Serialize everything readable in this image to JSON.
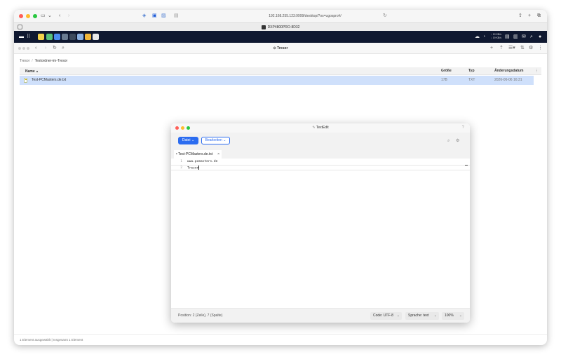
{
  "browser": {
    "url": "192.168.255.123:9999/desktop/?os=ugospro#/",
    "tab_title": "DXP4800PRO-8D32",
    "icons": [
      "sidebar-icon",
      "chevron-down-icon",
      "back-icon",
      "forward-icon",
      "shield-icon",
      "bitwarden-icon",
      "image-icon",
      "tab-icon",
      "reload-icon",
      "share-icon",
      "new-tab-icon",
      "tabs-overview-icon"
    ]
  },
  "nas": {
    "taskbar_icons": [
      "app-store-icon",
      "photos-icon",
      "file-manager-icon",
      "settings-icon",
      "monitor-icon",
      "docker-icon",
      "folder-icon",
      "textedit-icon"
    ],
    "speed_up": "↑ 19 KB/s",
    "speed_down": "↓ 19 KB/s"
  },
  "file_manager": {
    "title": "Tresor",
    "breadcrumb": [
      "Tresor",
      "Testordner-im-Tresor"
    ],
    "columns": {
      "name": "Name",
      "sort_arrow": "▲",
      "size": "Größe",
      "type": "Typ",
      "modified": "Änderungsdatum"
    },
    "rows": [
      {
        "name": "Test-PCMasters.de.txt",
        "size": "17B",
        "type": "TXT",
        "modified": "2026-06-06 16:31"
      }
    ],
    "status": "1 Element ausgewählt | Insgesamt 1 Element"
  },
  "textedit": {
    "window_title": "TextEdit",
    "help": "?",
    "menu_file": "Datei",
    "menu_edit": "Bearbeiten",
    "tab_label": "• Test-PCMasters.de.txt",
    "tab_close": "×",
    "lines": [
      {
        "num": "1",
        "text": "www.pcmasters.de"
      },
      {
        "num": "2",
        "text": "Tresor"
      }
    ],
    "status_position": "Position: 2 (Zeile), 7 (Spalte)",
    "encoding": "Code: UTF-8",
    "language": "Sprache: text",
    "zoom": "100%"
  }
}
